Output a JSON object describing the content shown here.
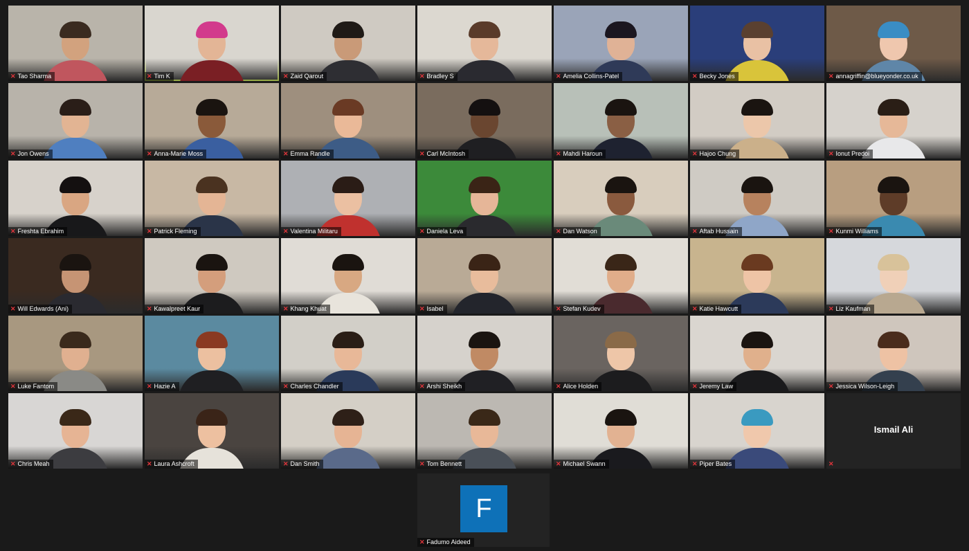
{
  "participants": [
    {
      "name": "Tao Sharma",
      "wall": "#b9b4aa",
      "shirt": "#c0565e",
      "hair": "#3a2b20",
      "skin": "#d2a27e"
    },
    {
      "name": "Tim K",
      "wall": "#d9d6cf",
      "shirt": "#7a1f24",
      "hair": "#d23a8c",
      "skin": "#e3b596",
      "active": true
    },
    {
      "name": "Zaid Qarout",
      "wall": "#cfcac2",
      "shirt": "#2e2e33",
      "hair": "#1f1a16",
      "skin": "#c99a78"
    },
    {
      "name": "Bradley S",
      "wall": "#dcd8d0",
      "shirt": "#2a2a30",
      "hair": "#5a3b2a",
      "skin": "#e5b89a"
    },
    {
      "name": "Amelia Collins-Patel",
      "wall": "#9aa4b8",
      "shirt": "#2f3a58",
      "hair": "#1b1620",
      "skin": "#e0b296"
    },
    {
      "name": "Becky Jones",
      "wall": "#2a3e7a",
      "shirt": "#d9c43a",
      "hair": "#5a4030",
      "skin": "#e9c1a4"
    },
    {
      "name": "annagriffin@blueyonder.co.uk",
      "wall": "#6e5a48",
      "shirt": "#5f86a8",
      "hair": "#3a8dc4",
      "skin": "#efc7ae"
    },
    {
      "name": "Jon Owens",
      "wall": "#b8b3aa",
      "shirt": "#4f7fc0",
      "hair": "#2a1e18",
      "skin": "#e2b493"
    },
    {
      "name": "Anna-Marie Moss",
      "wall": "#b7aa98",
      "shirt": "#3a5fa0",
      "hair": "#1a1410",
      "skin": "#8a5a3a"
    },
    {
      "name": "Emma Randle",
      "wall": "#9e8f7e",
      "shirt": "#3d5c86",
      "hair": "#6a3a24",
      "skin": "#eab998"
    },
    {
      "name": "Carl McIntosh",
      "wall": "#7a6c5e",
      "shirt": "#1f1f22",
      "hair": "#141010",
      "skin": "#6a4630"
    },
    {
      "name": "Mahdi Haroun",
      "wall": "#b8c0b8",
      "shirt": "#1e2230",
      "hair": "#1a1410",
      "skin": "#8a5f44"
    },
    {
      "name": "Hajoo Chung",
      "wall": "#d2ccc4",
      "shirt": "#cbb08a",
      "hair": "#1a1410",
      "skin": "#ecc7aa"
    },
    {
      "name": "Ionut Predoi",
      "wall": "#d6d2cc",
      "shirt": "#e8e8ea",
      "hair": "#2a1e16",
      "skin": "#e6b898"
    },
    {
      "name": "Freshta Ebrahim",
      "wall": "#d7d2cb",
      "shirt": "#18181a",
      "hair": "#141010",
      "skin": "#d9a682"
    },
    {
      "name": "Patrick Fleming",
      "wall": "#c8b8a4",
      "shirt": "#2a3448",
      "hair": "#4a3220",
      "skin": "#e4b595"
    },
    {
      "name": "Valentina Militaru",
      "wall": "#aeb0b4",
      "shirt": "#c0312e",
      "hair": "#2a1c16",
      "skin": "#ebc0a2"
    },
    {
      "name": "Daniela Leva",
      "wall": "#3c8a3a",
      "shirt": "#2a2a2e",
      "hair": "#3a2416",
      "skin": "#e6b698"
    },
    {
      "name": "Dan Watson",
      "wall": "#d8cdbd",
      "shirt": "#6a8a7a",
      "hair": "#1a1410",
      "skin": "#8a5a3e"
    },
    {
      "name": "Aftab Hussain",
      "wall": "#cfcbc4",
      "shirt": "#8fa6c8",
      "hair": "#1a1410",
      "skin": "#b7825e"
    },
    {
      "name": "Kunmi Williams",
      "wall": "#b89e80",
      "shirt": "#3a8ab0",
      "hair": "#1a1410",
      "skin": "#5e3c28"
    },
    {
      "name": "Will Edwards (Ani)",
      "wall": "#3a2a20",
      "shirt": "#2a2a30",
      "hair": "#1a1410",
      "skin": "#c69474"
    },
    {
      "name": "Kawalpreet Kaur",
      "wall": "#cfc9c0",
      "shirt": "#1c1c1e",
      "hair": "#1a1410",
      "skin": "#d49e7c"
    },
    {
      "name": "Khang Khuat",
      "wall": "#e0dcd6",
      "shirt": "#e8e4dc",
      "hair": "#1a1410",
      "skin": "#d8a882"
    },
    {
      "name": "Isabel",
      "wall": "#b9aa96",
      "shirt": "#23252c",
      "hair": "#3a2416",
      "skin": "#e8bc9c"
    },
    {
      "name": "Stefan Kudev",
      "wall": "#e1ddd6",
      "shirt": "#4a2a2e",
      "hair": "#3a2618",
      "skin": "#e0ad8a"
    },
    {
      "name": "Katie Hawcutt",
      "wall": "#c8b48e",
      "shirt": "#2c3a5a",
      "hair": "#6a3a20",
      "skin": "#eec4a6"
    },
    {
      "name": "Liz Kaufman",
      "wall": "#d6d8dc",
      "shirt": "#b8a890",
      "hair": "#d8c29a",
      "skin": "#f0d0b8"
    },
    {
      "name": "Luke Fantom",
      "wall": "#a89880",
      "shirt": "#8a8a86",
      "hair": "#3a2a1c",
      "skin": "#e0b090"
    },
    {
      "name": "Hazie A",
      "wall": "#5b8aa0",
      "shirt": "#1f1f22",
      "hair": "#8a3a22",
      "skin": "#ecc0a0"
    },
    {
      "name": "Charles Chandler",
      "wall": "#d2cfc8",
      "shirt": "#2a3a5a",
      "hair": "#2a1e16",
      "skin": "#e8b898"
    },
    {
      "name": "Arshi Sheikh",
      "wall": "#d6d2cc",
      "shirt": "#202024",
      "hair": "#1a1410",
      "skin": "#c08a64"
    },
    {
      "name": "Alice Holden",
      "wall": "#6a6460",
      "shirt": "#1c1c1e",
      "hair": "#8a6a48",
      "skin": "#eec6a8"
    },
    {
      "name": "Jeremy Law",
      "wall": "#dad6d0",
      "shirt": "#1a1a1c",
      "hair": "#1a1410",
      "skin": "#e0b08c"
    },
    {
      "name": "Jessica Wilson-Leigh",
      "wall": "#cfc6bd",
      "shirt": "#34404e",
      "hair": "#4a2c1c",
      "skin": "#eec2a4"
    },
    {
      "name": "Chris Meah",
      "wall": "#d8d6d4",
      "shirt": "#3c3c40",
      "hair": "#3a2818",
      "skin": "#e6b494"
    },
    {
      "name": "Laura Ashcroft",
      "wall": "#4a4440",
      "shirt": "#e6e2da",
      "hair": "#3a2418",
      "skin": "#edc0a0"
    },
    {
      "name": "Dan Smith",
      "wall": "#d4cfc6",
      "shirt": "#5a6a8a",
      "hair": "#2e2018",
      "skin": "#e6b494"
    },
    {
      "name": "Tom Bennett",
      "wall": "#bcb8b2",
      "shirt": "#4a5058",
      "hair": "#3a2818",
      "skin": "#e8b898"
    },
    {
      "name": "Michael Swann",
      "wall": "#e0ddd6",
      "shirt": "#1a1a1e",
      "hair": "#1a1410",
      "skin": "#e2b292"
    },
    {
      "name": "Piper Bates",
      "wall": "#d8d4ce",
      "shirt": "#3a4a7a",
      "hair": "#3a9ac0",
      "skin": "#f0c8ac"
    },
    {
      "name": "Ismail Ali",
      "blank": true
    }
  ],
  "bottom": {
    "name": "Fadumo Aideed",
    "initial": "F"
  },
  "colors": {
    "active_border": "#c7e35a",
    "muted_mic": "#e0353b",
    "avatar_bg": "#0e71b8"
  },
  "icons": {
    "muted": "muted-mic-icon"
  }
}
